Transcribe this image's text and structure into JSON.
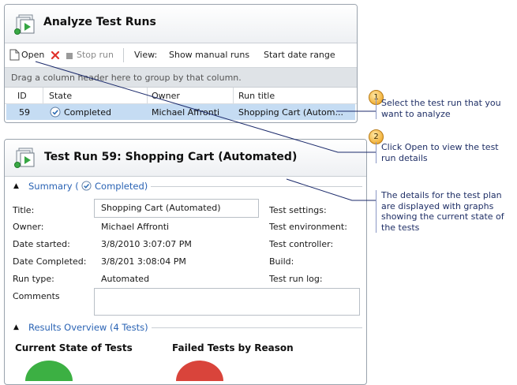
{
  "analyze": {
    "title": "Analyze Test Runs",
    "toolbar": {
      "open": "Open",
      "stop_run": "Stop run",
      "view_label": "View:",
      "show_manual_runs": "Show manual runs",
      "start_date_range": "Start date range"
    },
    "group_hint": "Drag a column header here to group by that column.",
    "columns": [
      "ID",
      "State",
      "Owner",
      "Run title"
    ],
    "row": {
      "id": "59",
      "state": "Completed",
      "owner": "Michael Affronti",
      "run_title": "Shopping Cart (Autom..."
    }
  },
  "details": {
    "title": "Test Run 59: Shopping Cart (Automated)",
    "summary": {
      "prefix": "Summary (",
      "status": "Completed",
      "suffix": ")"
    },
    "fields_left": [
      {
        "label": "Title:",
        "value": "Shopping Cart (Automated)"
      },
      {
        "label": "Owner:",
        "value": "Michael Affronti"
      },
      {
        "label": "Date started:",
        "value": "3/8/2010 3:07:07 PM"
      },
      {
        "label": "Date Completed:",
        "value": "3/8/201 3:08:04 PM"
      },
      {
        "label": "Run type:",
        "value": "Automated"
      },
      {
        "label": "Comments",
        "value": ""
      }
    ],
    "fields_right": [
      "Test settings:",
      "Test environment:",
      "Test controller:",
      "Build:",
      "Test run log:"
    ],
    "results_overview": "Results Overview (4 Tests)",
    "charts": [
      "Current State of Tests",
      "Failed Tests by Reason"
    ]
  },
  "callouts": [
    {
      "number": "1",
      "text": "Select the test run that you want to analyze"
    },
    {
      "number": "2",
      "text": "Click Open to view the test run details"
    },
    {
      "number": "",
      "text": "The details for the test plan are displayed with graphs showing the current state of the tests"
    }
  ],
  "colors": {
    "selected_row": "#c5dcf3",
    "link": "#2a63b4",
    "callout_text": "#1f2f66",
    "badge": "#f2b13a",
    "pass": "#3cb043",
    "fail": "#d9443b"
  }
}
